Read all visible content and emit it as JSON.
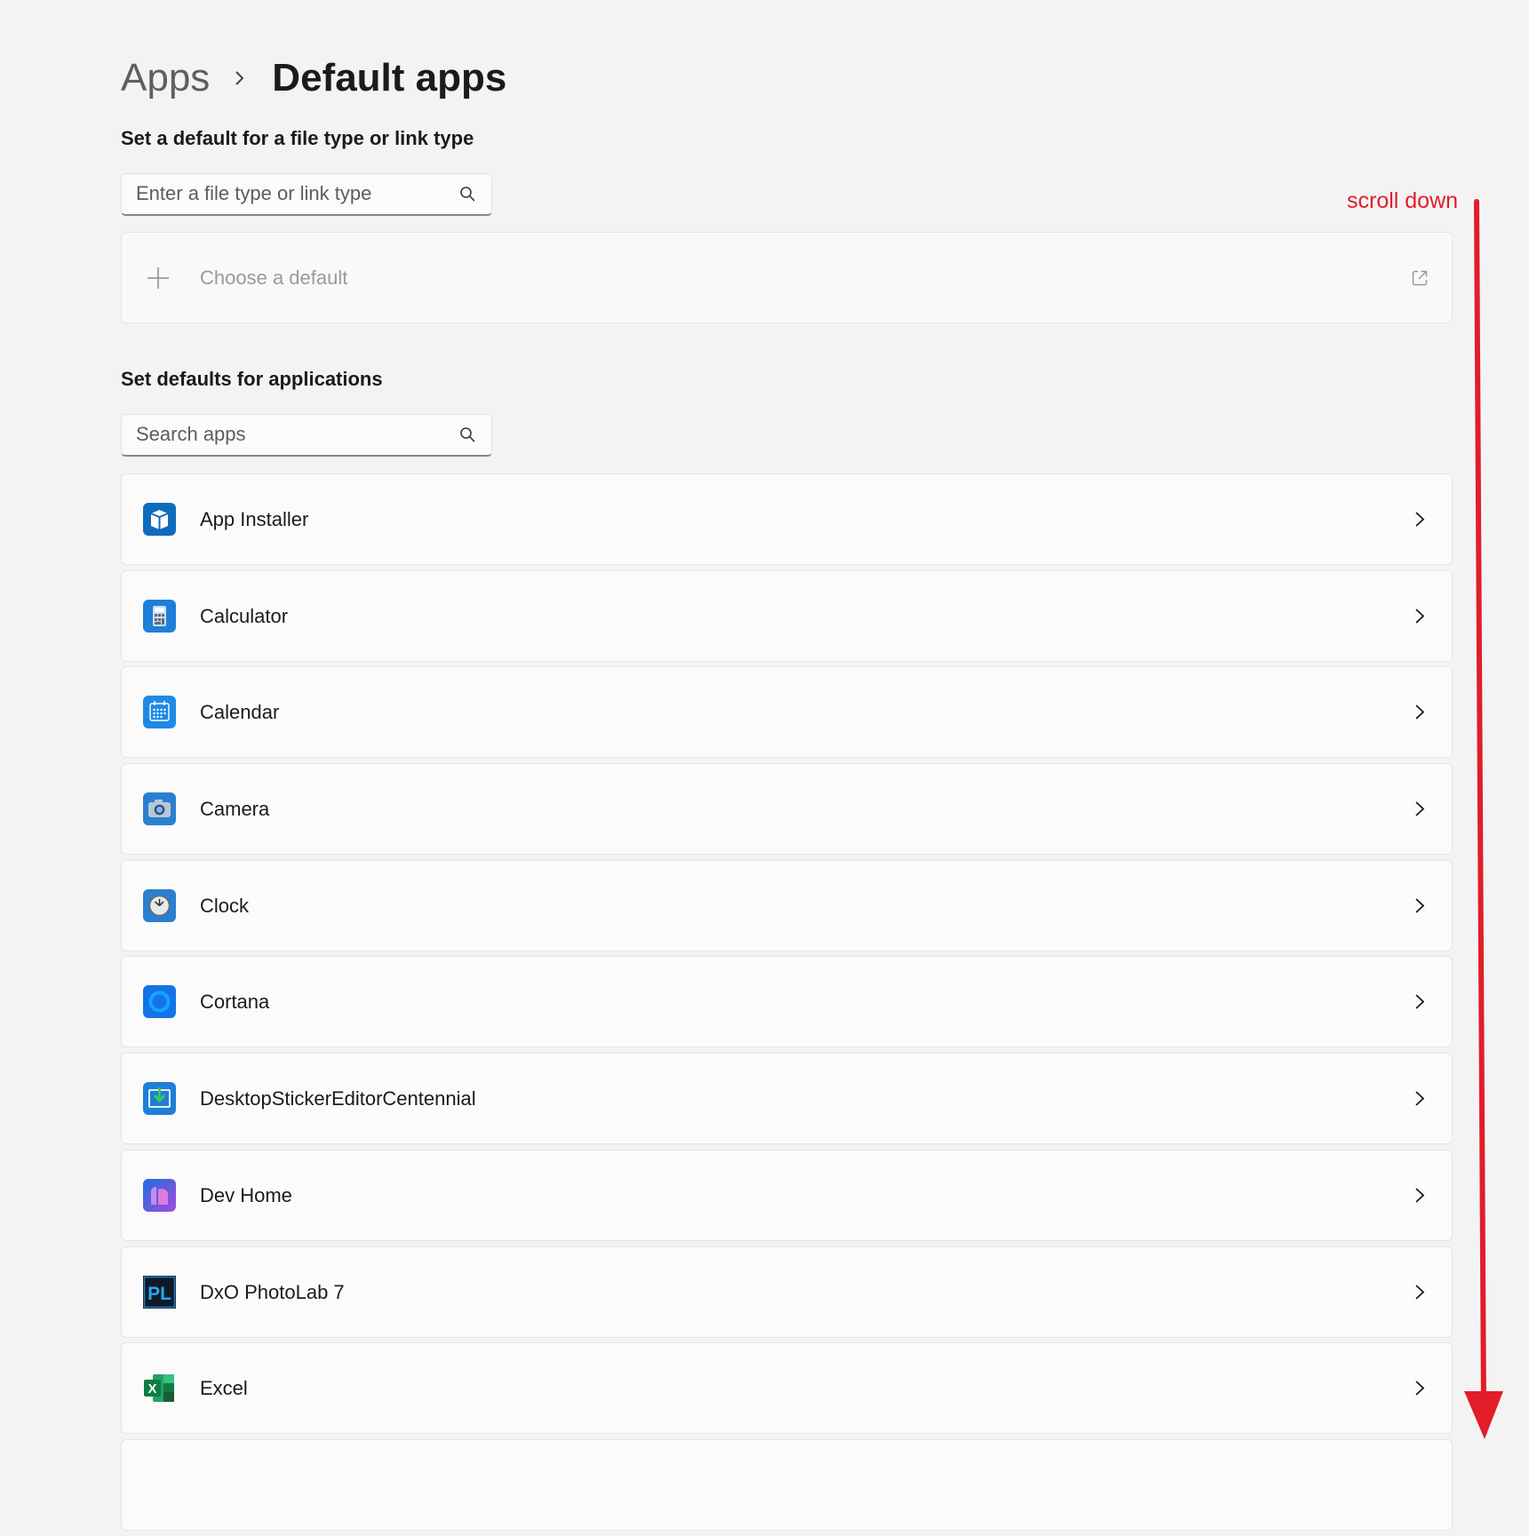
{
  "breadcrumb": {
    "parent": "Apps",
    "current": "Default apps"
  },
  "file_type_section": {
    "title": "Set a default for a file type or link type",
    "search_placeholder": "Enter a file type or link type",
    "search_value": "",
    "choose_default_label": "Choose a default"
  },
  "applications_section": {
    "title": "Set defaults for applications",
    "search_placeholder": "Search apps",
    "search_value": ""
  },
  "apps": [
    {
      "name": "App Installer",
      "icon": "app-installer-icon"
    },
    {
      "name": "Calculator",
      "icon": "calculator-icon"
    },
    {
      "name": "Calendar",
      "icon": "calendar-icon"
    },
    {
      "name": "Camera",
      "icon": "camera-icon"
    },
    {
      "name": "Clock",
      "icon": "clock-icon"
    },
    {
      "name": "Cortana",
      "icon": "cortana-icon"
    },
    {
      "name": "DesktopStickerEditorCentennial",
      "icon": "desktop-sticker-editor-icon"
    },
    {
      "name": "Dev Home",
      "icon": "dev-home-icon"
    },
    {
      "name": "DxO PhotoLab 7",
      "icon": "dxo-photolab-icon",
      "icon_text": "PL"
    },
    {
      "name": "Excel",
      "icon": "excel-icon",
      "icon_text": "X"
    }
  ],
  "annotation": {
    "text": "scroll down",
    "color": "#e21d29"
  },
  "colors": {
    "background": "#f3f3f3",
    "card": "#fbfbfb",
    "card_border": "#e5e5e5",
    "accent_blue": "#0f6cbd"
  }
}
